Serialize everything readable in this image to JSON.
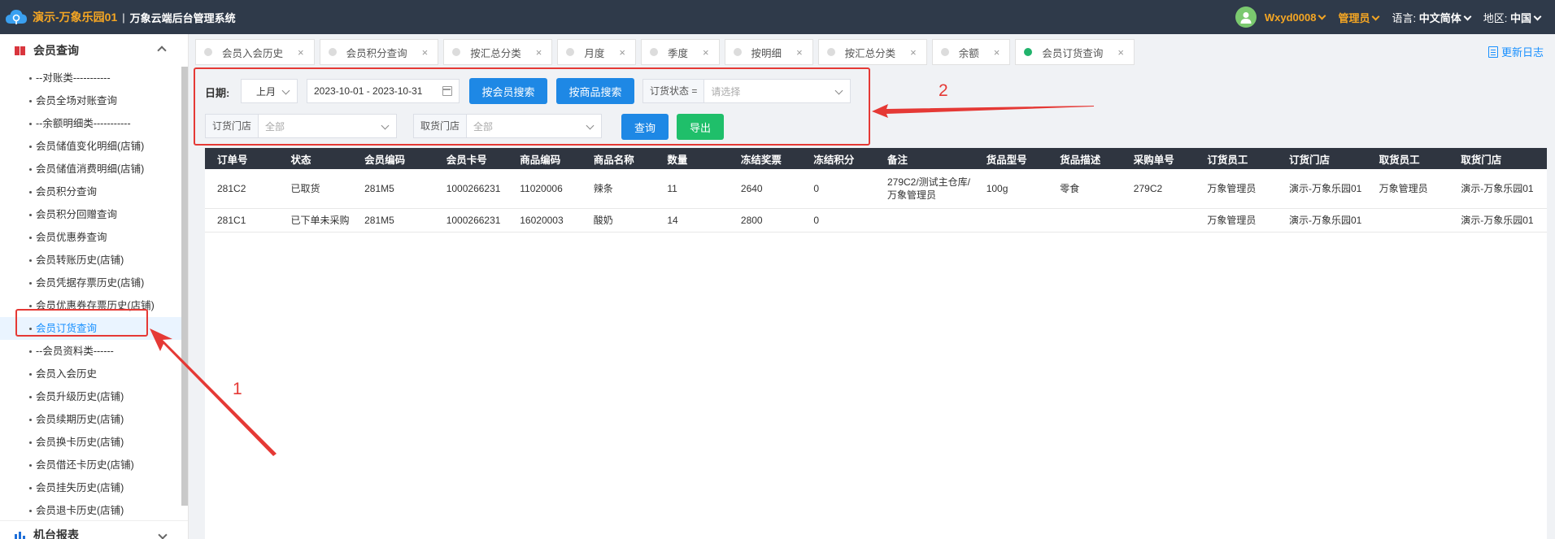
{
  "header": {
    "brand_name": "演示-万象乐园01",
    "separator": "|",
    "system_name": "万象云端后台管理系统",
    "username": "Wxyd0008",
    "role": "管理员",
    "language_label": "语言:",
    "language_value": "中文简体",
    "region_label": "地区:",
    "region_value": "中国"
  },
  "sidebar": {
    "group_title": "会员查询",
    "items": [
      "--对账类-----------",
      "会员全场对账查询",
      "--余额明细类-----------",
      "会员储值变化明细(店铺)",
      "会员储值消费明细(店铺)",
      "会员积分查询",
      "会员积分回赠查询",
      "会员优惠券查询",
      "会员转账历史(店铺)",
      "会员凭据存票历史(店铺)",
      "会员优惠券存票历史(店铺)",
      "会员订货查询",
      "--会员资料类------",
      "会员入会历史",
      "会员升级历史(店铺)",
      "会员续期历史(店铺)",
      "会员换卡历史(店铺)",
      "会员借还卡历史(店铺)",
      "会员挂失历史(店铺)",
      "会员退卡历史(店铺)"
    ],
    "next_group_title": "机台报表"
  },
  "tabs": [
    {
      "label": "会员入会历史",
      "close": "×"
    },
    {
      "label": "会员积分查询",
      "close": "×"
    },
    {
      "label": "按汇总分类",
      "close": "×"
    },
    {
      "label": "月度",
      "close": "×"
    },
    {
      "label": "季度",
      "close": "×"
    },
    {
      "label": "按明细",
      "close": "×"
    },
    {
      "label": "按汇总分类",
      "close": "×"
    },
    {
      "label": "余额",
      "close": "×"
    },
    {
      "label": "会员订货查询",
      "close": "×"
    }
  ],
  "update_log": "更新日志",
  "filters": {
    "date_label": "日期:",
    "period_value": "上月",
    "date_range": "2023-10-01 - 2023-10-31",
    "search_by_member": "按会员搜索",
    "search_by_product": "按商品搜索",
    "order_status_label": "订货状态 =",
    "order_status_placeholder": "请选择",
    "order_store_label": "订货门店",
    "order_store_value": "全部",
    "pickup_store_label": "取货门店",
    "pickup_store_value": "全部",
    "query_button": "查询",
    "export_button": "导出"
  },
  "table": {
    "columns": [
      "订单号",
      "状态",
      "会员编码",
      "会员卡号",
      "商品编码",
      "商品名称",
      "数量",
      "冻结奖票",
      "冻结积分",
      "备注",
      "货品型号",
      "货品描述",
      "采购单号",
      "订货员工",
      "订货门店",
      "取货员工",
      "取货门店"
    ],
    "rows": [
      [
        "281C2",
        "已取货",
        "281M5",
        "1000266231",
        "11020006",
        "辣条",
        "11",
        "2640",
        "0",
        "279C2/测试主仓库/万象管理员",
        "100g",
        "零食",
        "279C2",
        "万象管理员",
        "演示-万象乐园01",
        "万象管理员",
        "演示-万象乐园01"
      ],
      [
        "281C1",
        "已下单未采购",
        "281M5",
        "1000266231",
        "16020003",
        "酸奶",
        "14",
        "2800",
        "0",
        "",
        "",
        "",
        "",
        "万象管理员",
        "演示-万象乐园01",
        "",
        "演示-万象乐园01"
      ]
    ]
  },
  "annotations": {
    "label_1": "1",
    "label_2": "2",
    "color": "#e53935"
  }
}
